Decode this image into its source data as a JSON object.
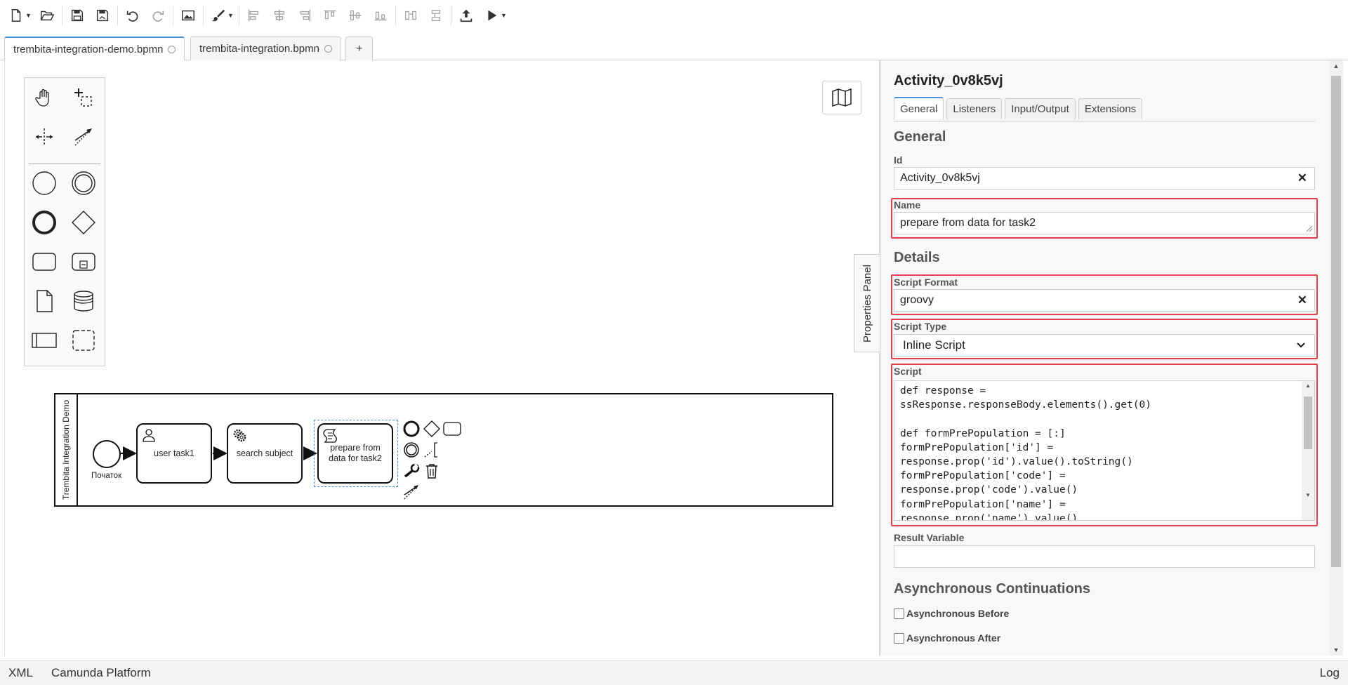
{
  "tabs": [
    {
      "label": "trembita-integration-demo.bpmn",
      "active": true
    },
    {
      "label": "trembita-integration.bpmn",
      "active": false
    }
  ],
  "add_tab_label": "+",
  "diagram": {
    "pool_label": "Trembita Integration Demo",
    "start_event_label": "Початок",
    "tasks": [
      {
        "label": "user task1",
        "icon": "user-icon"
      },
      {
        "label": "search subject",
        "icon": "gear-icon"
      },
      {
        "label": "prepare from data for task2",
        "icon": "script-icon"
      }
    ]
  },
  "properties_panel_tab_label": "Properties Panel",
  "properties": {
    "title": "Activity_0v8k5vj",
    "tabs": [
      "General",
      "Listeners",
      "Input/Output",
      "Extensions"
    ],
    "active_tab": "General",
    "general_heading": "General",
    "id_label": "Id",
    "id_value": "Activity_0v8k5vj",
    "name_label": "Name",
    "name_value": "prepare from data for task2",
    "details_heading": "Details",
    "script_format_label": "Script Format",
    "script_format_value": "groovy",
    "script_type_label": "Script Type",
    "script_type_value": "Inline Script",
    "script_label": "Script",
    "script_value": "def response =\nssResponse.responseBody.elements().get(0)\n\ndef formPrePopulation = [:]\nformPrePopulation['id'] =\nresponse.prop('id').value().toString()\nformPrePopulation['code'] =\nresponse.prop('code').value()\nformPrePopulation['name'] =\nresponse.prop('name').value()",
    "result_variable_label": "Result Variable",
    "result_variable_value": "",
    "async_heading": "Asynchronous Continuations",
    "async_before_label": "Asynchronous Before",
    "async_after_label": "Asynchronous After"
  },
  "status_bar": {
    "xml": "XML",
    "platform": "Camunda Platform",
    "log": "Log"
  },
  "colors": {
    "highlight": "#e0404a",
    "accent": "#4a90d9"
  }
}
